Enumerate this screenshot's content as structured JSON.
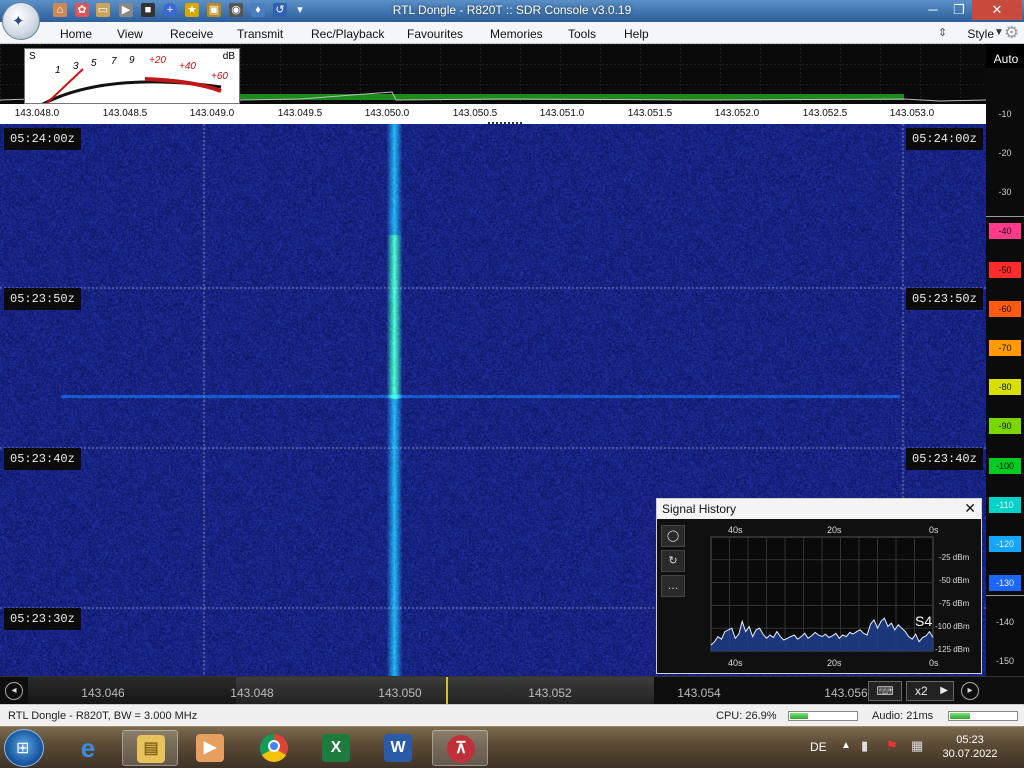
{
  "window": {
    "title": "RTL Dongle - R820T :: SDR Console v3.0.19"
  },
  "menu": {
    "items": [
      "Home",
      "View",
      "Receive",
      "Transmit",
      "Rec/Playback",
      "Favourites",
      "Memories",
      "Tools",
      "Help"
    ],
    "style_label": "Style"
  },
  "smeter": {
    "s_label": "S",
    "db_label": "dB",
    "scale": [
      "1",
      "3",
      "5",
      "7",
      "9",
      "+20",
      "+40",
      "+60"
    ]
  },
  "spectrum": {
    "auto_label": "Auto",
    "freq_ticks": [
      "143.048.0",
      "143.048.5",
      "143.049.0",
      "143.049.5",
      "143.050.0",
      "143.050.5",
      "143.051.0",
      "143.051.5",
      "143.052.0",
      "143.052.5",
      "143.053.0"
    ]
  },
  "waterfall": {
    "timestamps": [
      "05:24:00z",
      "05:23:50z",
      "05:23:40z",
      "05:23:30z"
    ]
  },
  "db_scale": {
    "labels": [
      "-10",
      "-20",
      "-30",
      "-40",
      "-50",
      "-60",
      "-70",
      "-80",
      "-90",
      "-100",
      "-110",
      "-120",
      "-130",
      "-140",
      "-150"
    ],
    "colors": [
      "#ff3a8a",
      "#ff2a2a",
      "#ff5a10",
      "#ff9a00",
      "#d8e000",
      "#7ad800",
      "#00cc22",
      "#00d4c8",
      "#12a6ff",
      "#1a66ff",
      "#1638d0",
      "#0f229a"
    ]
  },
  "bottom": {
    "freqs": [
      "143.046",
      "143.048",
      "143.050",
      "143.052",
      "143.054",
      "143.056"
    ],
    "x2_label": "x2"
  },
  "signal_history": {
    "title": "Signal History",
    "top_ticks": [
      "40s",
      "20s",
      "0s"
    ],
    "bottom_ticks": [
      "40s",
      "20s",
      "0s"
    ],
    "dbm_labels": [
      "-25 dBm",
      "-50 dBm",
      "-75 dBm",
      "-100 dBm",
      "-125 dBm"
    ],
    "s_reading": "S4",
    "trace": [
      -128,
      -124,
      -118,
      -121,
      -112,
      -110,
      -108,
      -120,
      -115,
      -100,
      -112,
      -106,
      -118,
      -110,
      -108,
      -115,
      -120,
      -116,
      -119,
      -112,
      -118,
      -122,
      -120,
      -118,
      -116,
      -121,
      -118,
      -114,
      -120,
      -117,
      -113,
      -116,
      -118,
      -115,
      -119,
      -117,
      -114,
      -120,
      -116,
      -118,
      -113,
      -115,
      -112,
      -110,
      -114,
      -116,
      -103,
      -98,
      -108,
      -100,
      -96,
      -106,
      -102,
      -110,
      -104,
      -108,
      -112,
      -118,
      -121,
      -115,
      -124,
      -119,
      -117,
      -112,
      -119
    ]
  },
  "status": {
    "device": "RTL Dongle - R820T, BW = 3.000 MHz",
    "cpu": "CPU: 26.9%",
    "audio": "Audio: 21ms",
    "cpu_level": 0.27,
    "audio_level": 0.3
  },
  "taskbar": {
    "lang": "DE",
    "time": "05:23",
    "date": "30.07.2022"
  }
}
